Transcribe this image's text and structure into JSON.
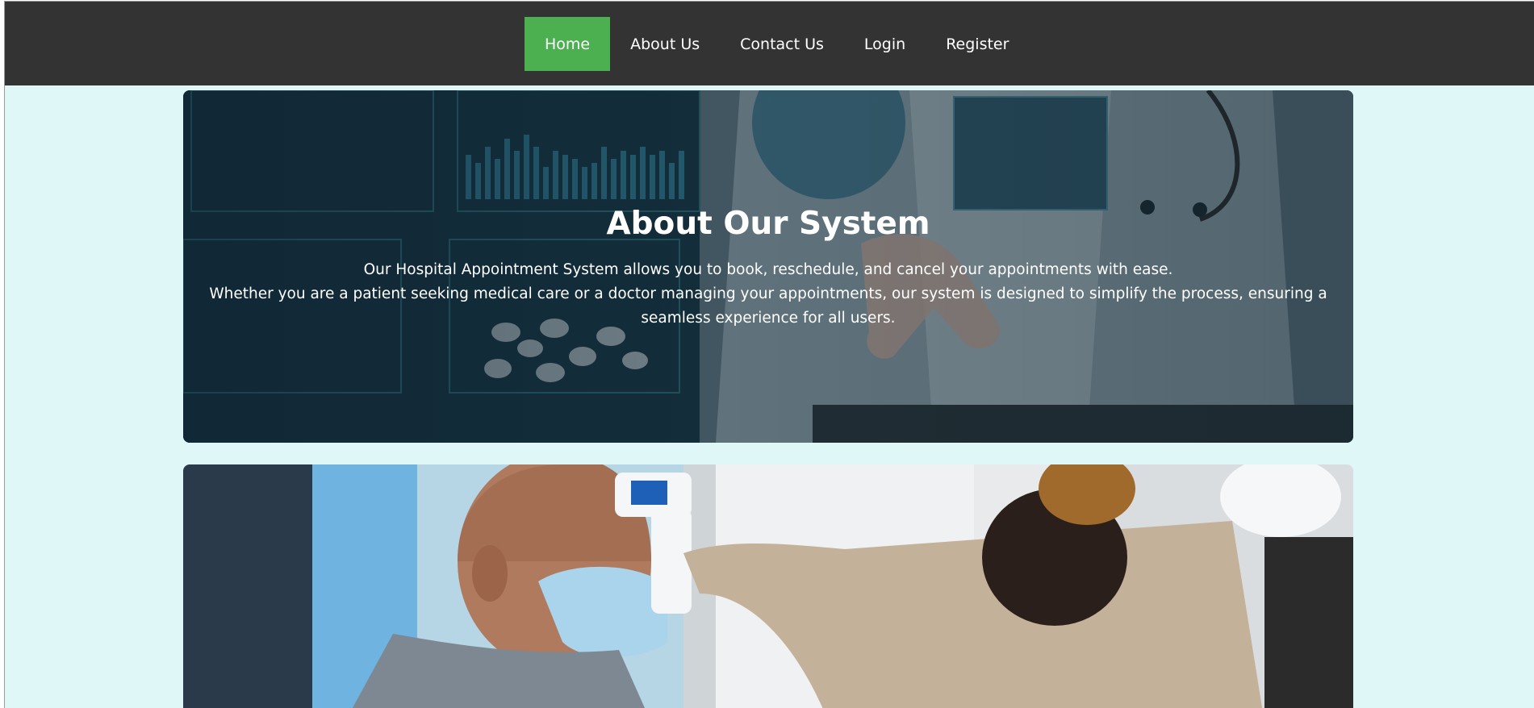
{
  "nav": {
    "items": [
      {
        "label": "Home",
        "active": true
      },
      {
        "label": "About Us",
        "active": false
      },
      {
        "label": "Contact Us",
        "active": false
      },
      {
        "label": "Login",
        "active": false
      },
      {
        "label": "Register",
        "active": false
      }
    ],
    "active_color": "#4caf50",
    "bar_color": "#333333"
  },
  "hero": {
    "title": "About Our System",
    "line1": "Our Hospital Appointment System allows you to book, reschedule, and cancel your appointments with ease.",
    "line2": "Whether you are a patient seeking medical care or a doctor managing your appointments, our system is designed to simplify the process, ensuring a seamless experience for all users."
  },
  "page": {
    "background_color": "#e0f7f8"
  }
}
